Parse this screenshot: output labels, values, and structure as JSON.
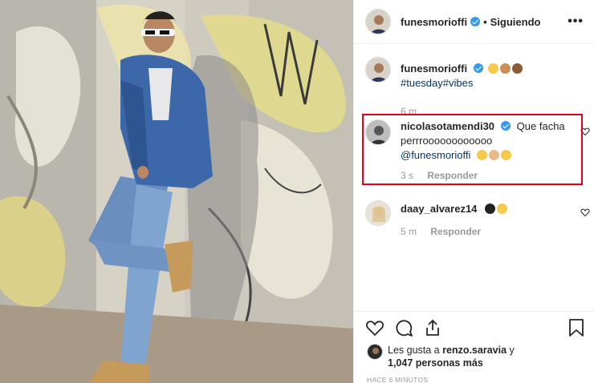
{
  "post": {
    "author": "funesmorioffi",
    "separator": "•",
    "follow_status": "Siguiendo",
    "more_icon": "more-options-icon"
  },
  "caption": {
    "username": "funesmorioffi",
    "emoji": [
      "sunglasses-emoji",
      "victory-hand-emoji",
      "thumbs-up-emoji"
    ],
    "hashtags": "#tuesday#vibes",
    "time": "6 m"
  },
  "comments": [
    {
      "username": "nicolasotamendi30",
      "verified": true,
      "text": "Que facha perrroooooooooooo",
      "mention": "@funesmorioffi",
      "emoji": [
        "sunglasses-emoji",
        "clapping-hands-emoji",
        "laughing-emoji"
      ],
      "time": "3 s",
      "reply_label": "Responder"
    },
    {
      "username": "daay_alvarez14",
      "verified": false,
      "emoji": [
        "black-heart-emoji",
        "star-struck-emoji"
      ],
      "time": "5 m",
      "reply_label": "Responder"
    }
  ],
  "likes": {
    "prefix": "Les gusta a",
    "user": "renzo.saravia",
    "conjunction": "y",
    "count_text": "1,047 personas más"
  },
  "time_ago": "HACE 6 MINUTOS",
  "colors": {
    "accent_blue": "#3897f0",
    "link_blue": "#003569",
    "highlight_red": "#e3001b",
    "muted_gray": "#999999"
  }
}
